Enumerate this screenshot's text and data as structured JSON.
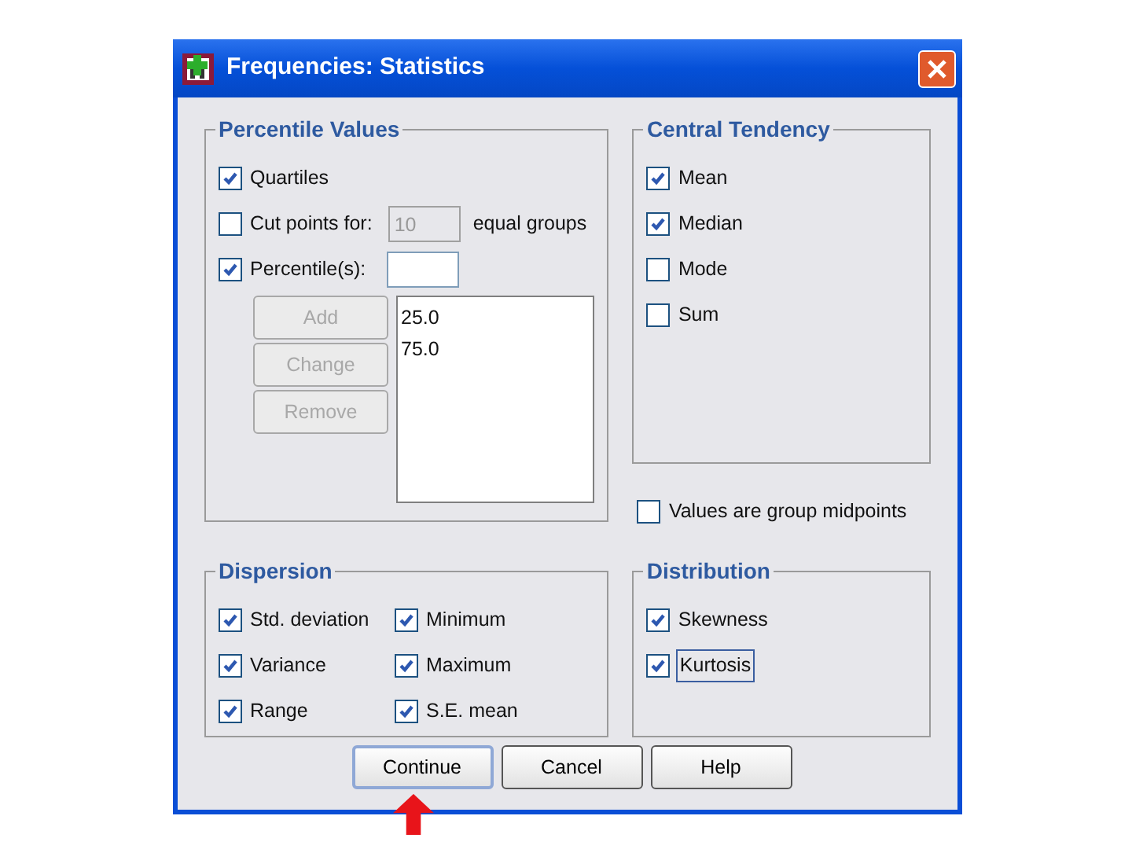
{
  "window": {
    "title": "Frequencies: Statistics"
  },
  "percentile_values": {
    "title": "Percentile Values",
    "quartiles": {
      "label": "Quartiles",
      "checked": true
    },
    "cut_points": {
      "label": "Cut points for:",
      "checked": false,
      "value": "10",
      "disabled": true,
      "suffix": "equal groups"
    },
    "percentiles": {
      "label": "Percentile(s):",
      "checked": true
    },
    "buttons": [
      {
        "label": "Add",
        "disabled": true
      },
      {
        "label": "Change",
        "disabled": true
      },
      {
        "label": "Remove",
        "disabled": true
      }
    ],
    "list": [
      "25.0",
      "75.0"
    ]
  },
  "central_tendency": {
    "title": "Central Tendency",
    "options": [
      {
        "label": "Mean",
        "checked": true
      },
      {
        "label": "Median",
        "checked": true
      },
      {
        "label": "Mode",
        "checked": false
      },
      {
        "label": "Sum",
        "checked": false
      }
    ]
  },
  "group_midpoints": {
    "label": "Values are group midpoints",
    "checked": false
  },
  "dispersion": {
    "title": "Dispersion",
    "options": [
      {
        "label": "Std. deviation",
        "checked": true
      },
      {
        "label": "Minimum",
        "checked": true
      },
      {
        "label": "Variance",
        "checked": true
      },
      {
        "label": "Maximum",
        "checked": true
      },
      {
        "label": "Range",
        "checked": true
      },
      {
        "label": "S.E. mean",
        "checked": true
      }
    ]
  },
  "distribution": {
    "title": "Distribution",
    "options": [
      {
        "label": "Skewness",
        "checked": true,
        "focused": false
      },
      {
        "label": "Kurtosis",
        "checked": true,
        "focused": true
      }
    ]
  },
  "buttons": [
    {
      "label": "Continue",
      "default": true
    },
    {
      "label": "Cancel",
      "default": false
    },
    {
      "label": "Help",
      "default": false
    }
  ]
}
